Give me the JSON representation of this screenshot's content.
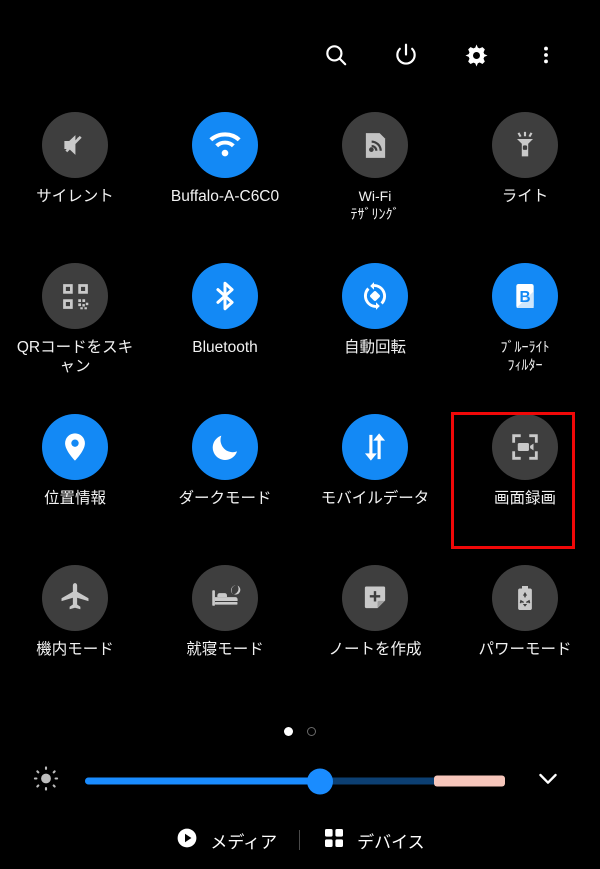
{
  "header": {
    "buttons": [
      {
        "name": "search-icon",
        "label": "検索"
      },
      {
        "name": "power-icon",
        "label": "電源"
      },
      {
        "name": "settings-icon",
        "label": "設定"
      },
      {
        "name": "overflow-menu-icon",
        "label": "その他のオプション"
      }
    ]
  },
  "tiles": [
    {
      "label": "サイレント",
      "icon": "volume-off-icon",
      "state": "off",
      "halfwidth": false
    },
    {
      "label": "Buffalo-A-C6C0",
      "icon": "wifi-icon",
      "state": "on",
      "halfwidth": false
    },
    {
      "label": "Wi-Fi テザリング",
      "icon": "hotspot-icon",
      "state": "off",
      "halfwidth": true,
      "line1": "Wi-Fi",
      "line2": "ﾃｻﾞﾘﾝｸﾞ"
    },
    {
      "label": "ライト",
      "icon": "flashlight-icon",
      "state": "off",
      "halfwidth": false
    },
    {
      "label": "QRコードをスキャン",
      "icon": "qr-code-icon",
      "state": "off",
      "halfwidth": false
    },
    {
      "label": "Bluetooth",
      "icon": "bluetooth-icon",
      "state": "on",
      "halfwidth": false
    },
    {
      "label": "自動回転",
      "icon": "auto-rotate-icon",
      "state": "on",
      "halfwidth": false
    },
    {
      "label": "ブルーライトフィルター",
      "icon": "blue-light-filter-icon",
      "state": "on",
      "halfwidth": true,
      "line1": "ﾌﾞﾙｰﾗｲﾄ",
      "line2": "ﾌｨﾙﾀｰ"
    },
    {
      "label": "位置情報",
      "icon": "location-pin-icon",
      "state": "on",
      "halfwidth": false
    },
    {
      "label": "ダークモード",
      "icon": "moon-icon",
      "state": "on",
      "halfwidth": false
    },
    {
      "label": "モバイルデータ",
      "icon": "mobile-data-icon",
      "state": "on",
      "halfwidth": false
    },
    {
      "label": "画面録画",
      "icon": "screen-record-icon",
      "state": "off",
      "halfwidth": false
    },
    {
      "label": "機内モード",
      "icon": "airplane-icon",
      "state": "off",
      "halfwidth": false
    },
    {
      "label": "就寝モード",
      "icon": "bedtime-icon",
      "state": "off",
      "halfwidth": false
    },
    {
      "label": "ノートを作成",
      "icon": "new-note-icon",
      "state": "off",
      "halfwidth": false
    },
    {
      "label": "パワーモード",
      "icon": "power-saver-icon",
      "state": "off",
      "halfwidth": false
    }
  ],
  "highlight": {
    "target_label": "画面録画",
    "color": "#f00808"
  },
  "pager": {
    "pages": 2,
    "active_index": 0
  },
  "brightness": {
    "icon": "brightness-icon",
    "value_percent": 56,
    "warm_segment_percent": 17,
    "expand_icon": "chevron-down-icon"
  },
  "footer": {
    "media": {
      "label": "メディア",
      "icon": "play-circle-icon"
    },
    "devices": {
      "label": "デバイス",
      "icon": "grid-squares-icon"
    }
  },
  "colors": {
    "background": "#000000",
    "accent_on": "#1389f5",
    "tile_off": "#3e3e3e",
    "slider_blue": "#1a8cff",
    "slider_warm": "#f6c6bb",
    "highlight_red": "#f00808"
  }
}
